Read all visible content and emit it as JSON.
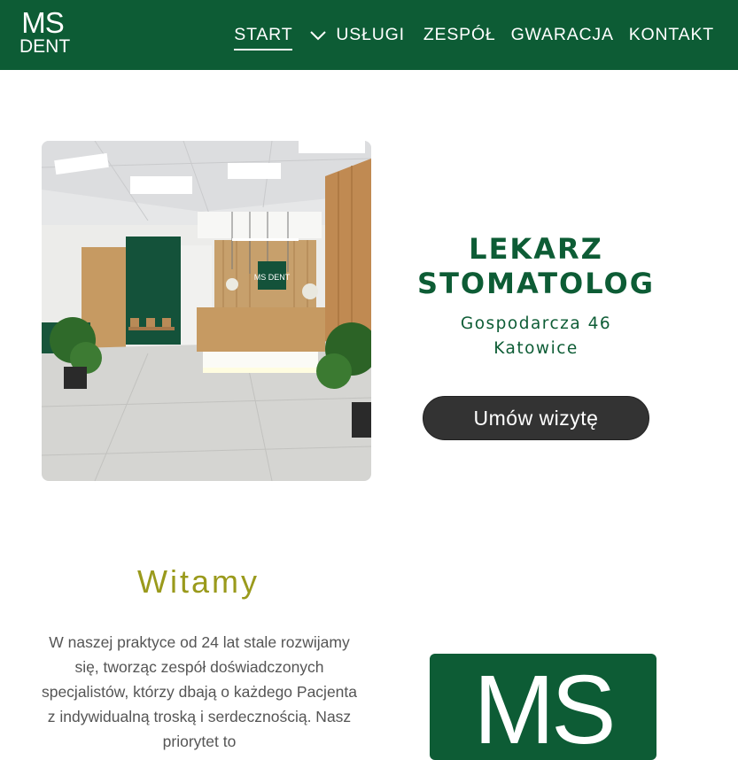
{
  "brand": {
    "logo_top": "MS",
    "logo_bottom": "DENT",
    "card_text": "MS"
  },
  "nav": {
    "items": [
      {
        "label": "START",
        "active": true
      },
      {
        "label": "USŁUGI",
        "has_dropdown": true
      },
      {
        "label": "ZESPÓŁ"
      },
      {
        "label": "GWARACJA"
      },
      {
        "label": "KONTAKT"
      }
    ]
  },
  "hero": {
    "title_line1": "LEKARZ",
    "title_line2": "STOMATOLOG",
    "address_line1": "Gospodarcza 46",
    "address_line2": "Katowice",
    "cta_label": "Umów wizytę",
    "photo_sign": "MS DENT"
  },
  "welcome": {
    "heading": "Witamy",
    "text": "W naszej praktyce od 24 lat stale rozwijamy się, tworząc zespół doświadczonych specjalistów, którzy dbają o każdego Pacjenta z indywidualną troską i serdecznością. Nasz priorytet to"
  },
  "colors": {
    "brand_green": "#0d5c35",
    "accent_olive": "#9a9a1c",
    "button_dark": "#333333"
  }
}
